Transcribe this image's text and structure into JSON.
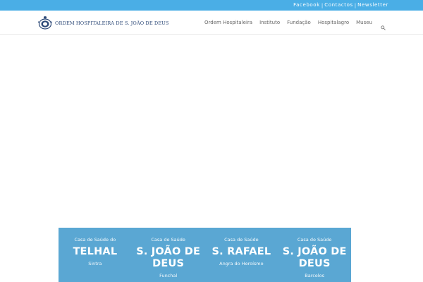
{
  "topbar": {
    "links": [
      "Facebook",
      "Contactos",
      "Newsletter"
    ],
    "separator": "|"
  },
  "header": {
    "logo_text": "ORDEM HOSPITALEIRA DE S. JOÃO DE DEUS",
    "logo_icon": "coat-of-arms-icon",
    "nav": [
      "Ordem Hospitaleira",
      "Instituto",
      "Fundação",
      "Hospitalagro",
      "Museu"
    ],
    "search_icon": "search-icon"
  },
  "houses": [
    {
      "pre": "Casa de Saúde do",
      "name": "TELHAL",
      "location": "Sintra"
    },
    {
      "pre": "Casa de Saúde",
      "name": "S. JOÃO DE DEUS",
      "location": "Funchal"
    },
    {
      "pre": "Casa de Saúde",
      "name": "S. RAFAEL",
      "location": "Angra do Heroísmo"
    },
    {
      "pre": "Casa de Saúde",
      "name": "S. JOÃO DE DEUS",
      "location": "Barcelos"
    }
  ],
  "colors": {
    "topbar": "#4aaee6",
    "houses_panel": "#5aa7d3",
    "logo_text": "#2e4a78",
    "nav_text": "#666666"
  }
}
